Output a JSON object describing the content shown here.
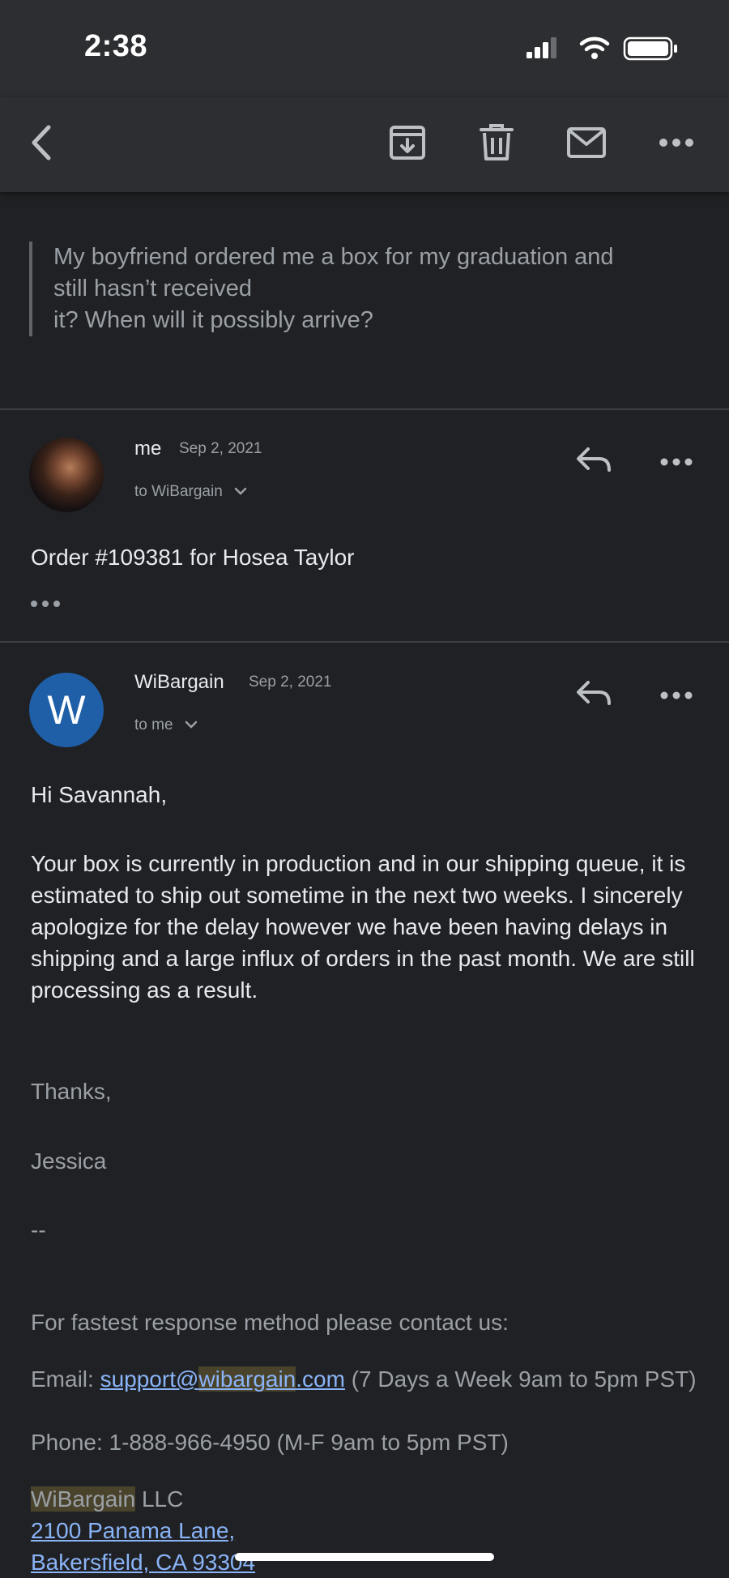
{
  "status_bar": {
    "time": "2:38"
  },
  "toolbar": {
    "back": "back-icon",
    "archive": "archive-icon",
    "delete": "trash-icon",
    "mark_unread": "mail-icon",
    "more": "more-icon"
  },
  "quoted_text": "My boyfriend ordered me a box for my graduation and\nstill hasn’t received\nit? When will it possibly arrive?",
  "messages": [
    {
      "sender": "me",
      "date": "Sep 2, 2021",
      "recipient": "to WiBargain",
      "subject": "Order #109381 for Hosea Taylor"
    },
    {
      "sender": "WiBargain",
      "avatar_letter": "W",
      "date": "Sep 2, 2021",
      "recipient": "to me",
      "greeting": "Hi Savannah,",
      "body": "Your box is currently in production and in our shipping queue, it is estimated to ship out sometime in the next two weeks. I sincerely apologize for the delay however we have been having delays in shipping and a large influx of orders in the past month. We are still processing as a result.",
      "thanks": "Thanks,",
      "signature": "Jessica",
      "separator": "--",
      "contact_intro": "For fastest response method please contact us:",
      "email_label": "Email: ",
      "email_prefix": "support@",
      "email_domain": "wibargain",
      "email_suffix": ".com",
      "email_hours": " (7 Days a Week 9am to 5pm PST)",
      "phone_line": "Phone: 1-888-966-4950 (M-F 9am to 5pm PST)",
      "company_name": "WiBargain",
      "company_suffix": " LLC",
      "address_line1": "2100 Panama Lane,",
      "address_line2": "Bakersfield, CA 93304"
    }
  ],
  "colors": {
    "background": "#202124",
    "accent_blue": "#1f5fa8",
    "link": "#8ab4f8"
  }
}
